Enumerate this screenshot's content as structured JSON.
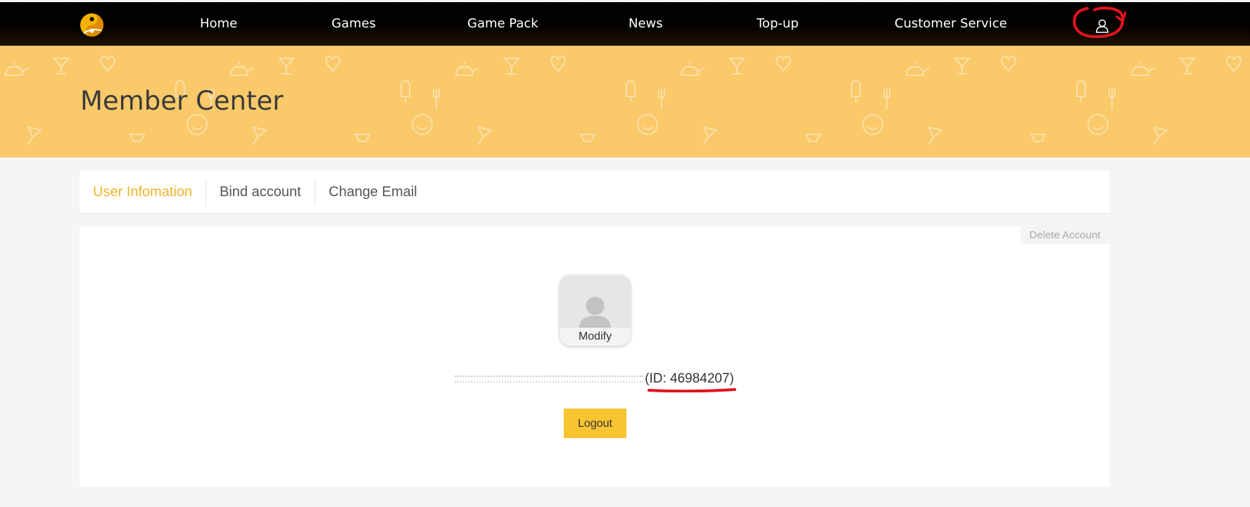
{
  "nav": {
    "logo": "tencent-penguin-logo",
    "items": [
      {
        "label": "Home"
      },
      {
        "label": "Games"
      },
      {
        "label": "Game Pack"
      },
      {
        "label": "News"
      },
      {
        "label": "Top-up"
      },
      {
        "label": "Customer Service"
      }
    ],
    "user_icon": "user-profile-icon"
  },
  "banner": {
    "title": "Member Center"
  },
  "tabs": [
    {
      "label": "User Infomation",
      "active": true
    },
    {
      "label": "Bind account",
      "active": false
    },
    {
      "label": "Change Email",
      "active": false
    }
  ],
  "profile": {
    "delete_account_label": "Delete Account",
    "avatar_modify_label": "Modify",
    "user_id_open": "(",
    "user_id": "ID: 46984207",
    "user_id_close": ")",
    "logout_label": "Logout"
  },
  "colors": {
    "accent": "#f0b42a",
    "banner": "#f9c96a",
    "button": "#f8c531",
    "annotation": "#e0141e"
  }
}
